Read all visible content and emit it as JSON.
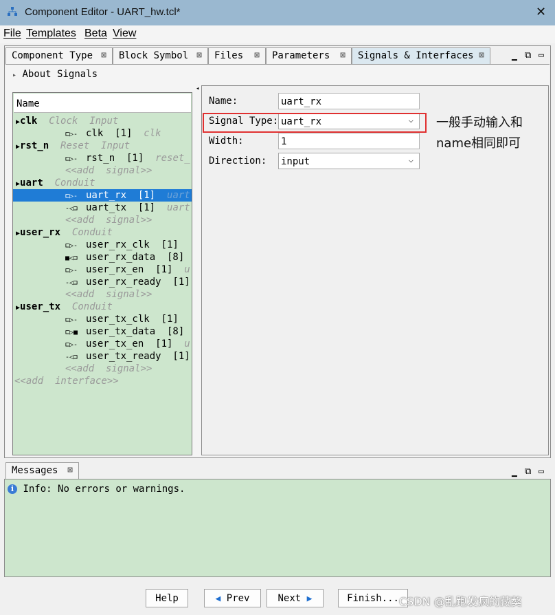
{
  "window": {
    "title": "Component Editor - UART_hw.tcl*"
  },
  "menu": {
    "file": "File",
    "templates": "Templates",
    "beta": "Beta",
    "view": "View"
  },
  "tabs": [
    {
      "label": "Component Type"
    },
    {
      "label": "Block Symbol"
    },
    {
      "label": "Files"
    },
    {
      "label": "Parameters"
    },
    {
      "label": "Signals & Interfaces"
    }
  ],
  "tab_close_glyph": "⊠",
  "about": {
    "label": "About Signals"
  },
  "tree": {
    "header": "Name",
    "rows": [
      {
        "name": "clk",
        "icon": "▶",
        "meta": "Clock  Input"
      },
      {
        "name": "clk  [1]",
        "icon": "⊏▷-",
        "meta": "clk"
      },
      {
        "name": "rst_n",
        "icon": "▶",
        "meta": "Reset  Input"
      },
      {
        "name": "rst_n  [1]",
        "icon": "⊏▷-",
        "meta": "reset_"
      },
      {
        "name": "<<add  signal>>"
      },
      {
        "name": "uart",
        "icon": "▶",
        "meta": "Conduit"
      },
      {
        "name": "uart_rx  [1]",
        "icon": "⊏▷-",
        "meta": "uart"
      },
      {
        "name": "uart_tx  [1]",
        "icon": "-◁⊐",
        "meta": "uart"
      },
      {
        "name": "<<add  signal>>"
      },
      {
        "name": "user_rx",
        "icon": "▶",
        "meta": "Conduit"
      },
      {
        "name": "user_rx_clk  [1]",
        "icon": "⊏▷-"
      },
      {
        "name": "user_rx_data  [8]",
        "icon": "■◁⊐"
      },
      {
        "name": "user_rx_en  [1]",
        "icon": "⊏▷-",
        "meta": "u"
      },
      {
        "name": "user_rx_ready  [1]",
        "icon": "-◁⊐"
      },
      {
        "name": "<<add  signal>>"
      },
      {
        "name": "user_tx",
        "icon": "▶",
        "meta": "Conduit"
      },
      {
        "name": "user_tx_clk  [1]",
        "icon": "⊏▷-"
      },
      {
        "name": "user_tx_data  [8]",
        "icon": "⊏▷■"
      },
      {
        "name": "user_tx_en  [1]",
        "icon": "⊏▷-",
        "meta": "u"
      },
      {
        "name": "user_tx_ready  [1]",
        "icon": "-◁⊐"
      },
      {
        "name": "<<add  signal>>"
      },
      {
        "name": "<<add  interface>>"
      }
    ]
  },
  "details": {
    "name": {
      "label": "Name:",
      "value": "uart_rx"
    },
    "signal_type": {
      "label": "Signal Type:",
      "value": "uart_rx"
    },
    "width": {
      "label": "Width:",
      "value": "1"
    },
    "direction": {
      "label": "Direction:",
      "value": "input"
    }
  },
  "annotation": {
    "line1": "一般手动输入和",
    "line2": "name相同即可"
  },
  "messages": {
    "tab": "Messages",
    "info_prefix": "Info:",
    "info_text": "No errors or warnings."
  },
  "buttons": {
    "help": "Help",
    "prev": "Prev",
    "next": "Next",
    "finish": "Finish..."
  },
  "watermark": "CSDN @乱跑发疯的藏獒",
  "colors": {
    "accent": "#1f7cd6",
    "panel_green": "#cde6cd",
    "titlebar": "#9ab8d0",
    "highlight": "#e03030"
  }
}
